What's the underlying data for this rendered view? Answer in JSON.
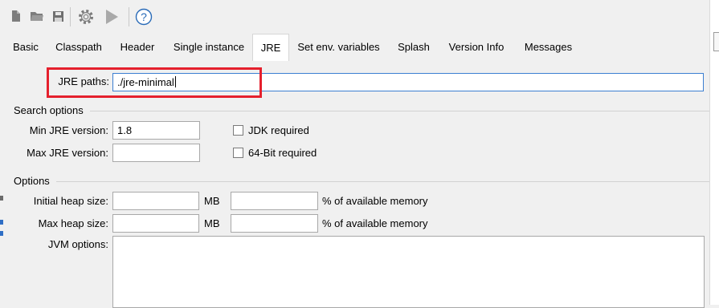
{
  "toolbar": {
    "buttons": [
      {
        "icon": "new-file-icon"
      },
      {
        "icon": "open-folder-icon"
      },
      {
        "icon": "save-icon"
      },
      {
        "icon": "settings-gear-icon"
      },
      {
        "icon": "run-play-icon"
      },
      {
        "icon": "help-icon",
        "glyph": "?"
      }
    ]
  },
  "tabs": [
    {
      "label": "Basic"
    },
    {
      "label": "Classpath"
    },
    {
      "label": "Header"
    },
    {
      "label": "Single instance"
    },
    {
      "label": "JRE",
      "active": true
    },
    {
      "label": "Set env. variables"
    },
    {
      "label": "Splash"
    },
    {
      "label": "Version Info"
    },
    {
      "label": "Messages"
    }
  ],
  "jre": {
    "paths_label": "JRE paths:",
    "paths_value": "./jre-minimal"
  },
  "search_options": {
    "title": "Search options",
    "min_label": "Min JRE version:",
    "min_value": "1.8",
    "max_label": "Max JRE version:",
    "max_value": "",
    "jdk_required_label": "JDK required",
    "jdk_required_checked": false,
    "bit64_required_label": "64-Bit required",
    "bit64_required_checked": false
  },
  "options": {
    "title": "Options",
    "initial_heap_label": "Initial heap size:",
    "initial_heap_value": "",
    "initial_heap_unit": "MB",
    "initial_heap_percent": "",
    "initial_heap_percent_label": "% of available memory",
    "max_heap_label": "Max heap size:",
    "max_heap_value": "",
    "max_heap_unit": "MB",
    "max_heap_percent": "",
    "max_heap_percent_label": "% of available memory",
    "jvm_options_label": "JVM options:",
    "jvm_options_value": ""
  },
  "colors": {
    "highlight": "#e5202d",
    "focus_border": "#3c7fd1",
    "background": "#f0f0f0"
  }
}
